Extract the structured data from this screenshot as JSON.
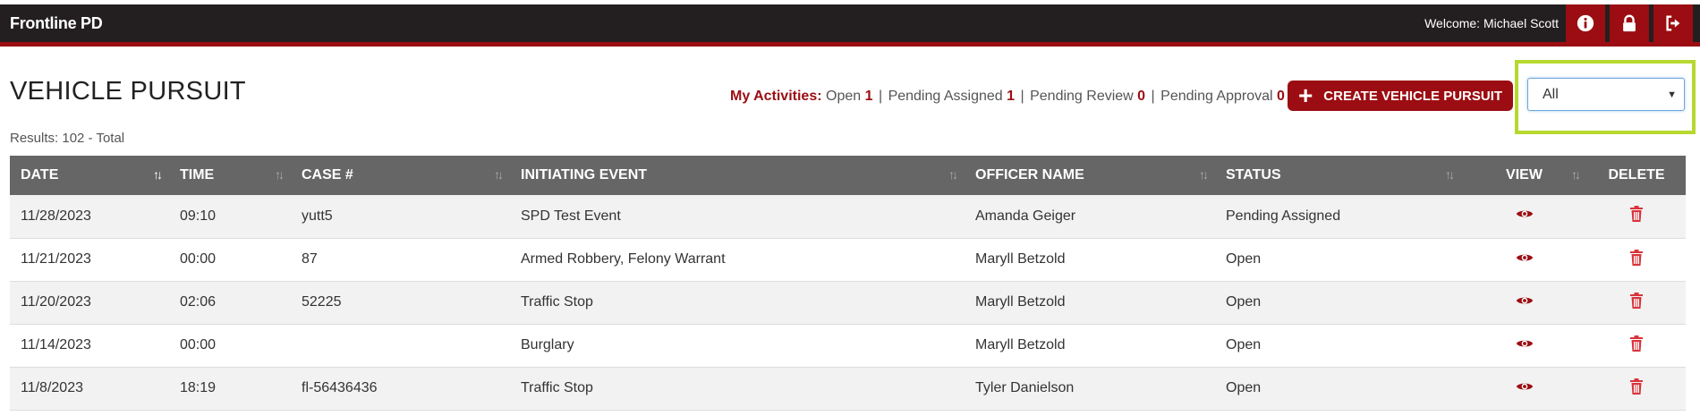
{
  "app": {
    "brand": "Frontline PD",
    "welcome": "Welcome: Michael Scott"
  },
  "header_icons": [
    "info-icon",
    "lock-icon",
    "sign-out-icon"
  ],
  "page": {
    "title": "VEHICLE PURSUIT",
    "results": "Results: 102 - Total"
  },
  "activities": {
    "label": "My Activities:",
    "items": [
      {
        "label": "Open",
        "count": "1"
      },
      {
        "label": "Pending Assigned",
        "count": "1"
      },
      {
        "label": "Pending Review",
        "count": "0"
      },
      {
        "label": "Pending Approval",
        "count": "0"
      }
    ]
  },
  "create_button": {
    "label": "CREATE VEHICLE PURSUIT",
    "icon": "plus-icon"
  },
  "filter": {
    "selected": "All"
  },
  "colors": {
    "brand_red": "#9b0d12",
    "topbar": "#231f20",
    "header_gray": "#666666",
    "highlight": "#b6d82f"
  },
  "table": {
    "columns": [
      "DATE",
      "TIME",
      "CASE #",
      "INITIATING EVENT",
      "OFFICER NAME",
      "STATUS",
      "VIEW",
      "DELETE"
    ],
    "rows": [
      {
        "date": "11/28/2023",
        "time": "09:10",
        "case": "yutt5",
        "event": "SPD Test Event",
        "officer": "Amanda Geiger",
        "status": "Pending Assigned"
      },
      {
        "date": "11/21/2023",
        "time": "00:00",
        "case": "87",
        "event": "Armed Robbery, Felony Warrant",
        "officer": "Maryll Betzold",
        "status": "Open"
      },
      {
        "date": "11/20/2023",
        "time": "02:06",
        "case": "52225",
        "event": "Traffic Stop",
        "officer": "Maryll Betzold",
        "status": "Open"
      },
      {
        "date": "11/14/2023",
        "time": "00:00",
        "case": "",
        "event": "Burglary",
        "officer": "Maryll Betzold",
        "status": "Open"
      },
      {
        "date": "11/8/2023",
        "time": "18:19",
        "case": "fl-56436436",
        "event": "Traffic Stop",
        "officer": "Tyler Danielson",
        "status": "Open"
      }
    ]
  }
}
